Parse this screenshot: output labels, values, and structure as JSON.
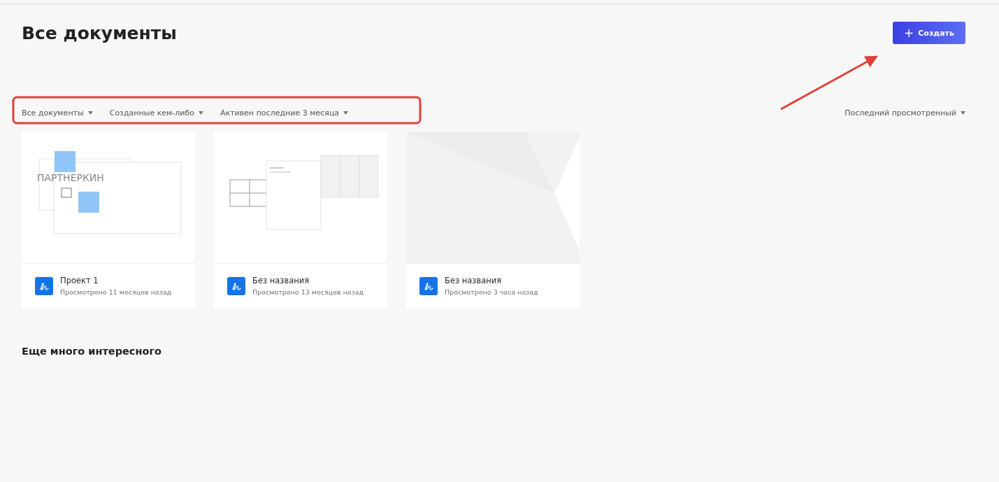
{
  "title": "Все документы",
  "create_button": {
    "icon": "+",
    "label": "Создать"
  },
  "filters": [
    {
      "label": "Все документы"
    },
    {
      "label": "Созданные кем-либо"
    },
    {
      "label": "Активен последние 3 месяца"
    }
  ],
  "sort": {
    "label": "Последний просмотренный"
  },
  "documents": [
    {
      "name": "Проект 1",
      "viewed": "Просмотрено 11 месяцев назад",
      "thumbnail": {
        "kind": "sketch",
        "text": "ПАРТНЕРКИН"
      }
    },
    {
      "name": "Без названия",
      "viewed": "Просмотрено 13 месяцев назад",
      "thumbnail": {
        "kind": "board"
      }
    },
    {
      "name": "Без названия",
      "viewed": "Просмотрено 3 часа назад",
      "thumbnail": {
        "kind": "blank"
      }
    }
  ],
  "section_title": "Еще много интересного",
  "annotations": {
    "highlight_box": true,
    "arrow": true
  }
}
